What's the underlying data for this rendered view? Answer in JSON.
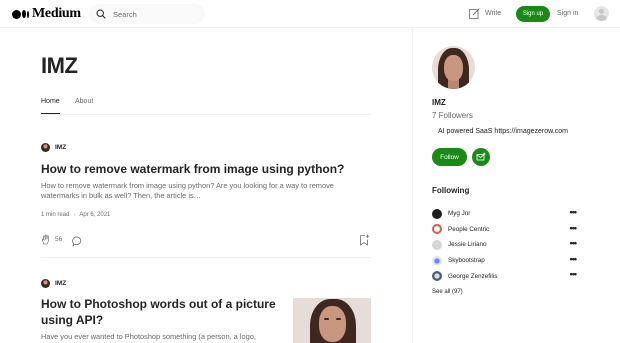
{
  "header": {
    "logo_text": "Medium",
    "search_placeholder": "Search",
    "write_label": "Write",
    "signup_label": "Sign up",
    "signin_label": "Sign in"
  },
  "publication": {
    "title": "IMZ",
    "tabs": [
      {
        "label": "Home",
        "active": true
      },
      {
        "label": "About",
        "active": false
      }
    ]
  },
  "articles": [
    {
      "author": "IMZ",
      "title": "How to remove watermark from image using python?",
      "subtitle_line1": "How to remove watermark from image using python? Are you looking for a way to remove",
      "subtitle_line2": "watermarks in bulk as well? Then, the article is…",
      "read_time": "1 min read",
      "date": "Apr 6, 2021",
      "claps": "56"
    },
    {
      "author": "IMZ",
      "title_line1": "How to Photoshop words out of a picture",
      "title_line2": "using API?",
      "subtitle_line1": "Have you ever wanted to Photoshop something (a person, a logo,"
    }
  ],
  "sidebar": {
    "name": "IMZ",
    "followers": "7 Followers",
    "bio": "AI powered SaaS https://imagezerow.com",
    "follow_label": "Follow",
    "following_title": "Following",
    "following": [
      {
        "name": "Myg Jnr",
        "avatar_color": "#1f1f1f"
      },
      {
        "name": "People Centric",
        "avatar_color": "#e05a4f"
      },
      {
        "name": "Jessie Liriano",
        "avatar_color": "#c8c8c8"
      },
      {
        "name": "Skybootstrap",
        "avatar_color": "#3b5bdb"
      },
      {
        "name": "George Zenzefilis",
        "avatar_color": "#5a6b7a"
      }
    ],
    "see_all": "See all (97)"
  },
  "colors": {
    "accent": "#1a8917",
    "text": "#242424",
    "muted": "#6b6b6b"
  }
}
